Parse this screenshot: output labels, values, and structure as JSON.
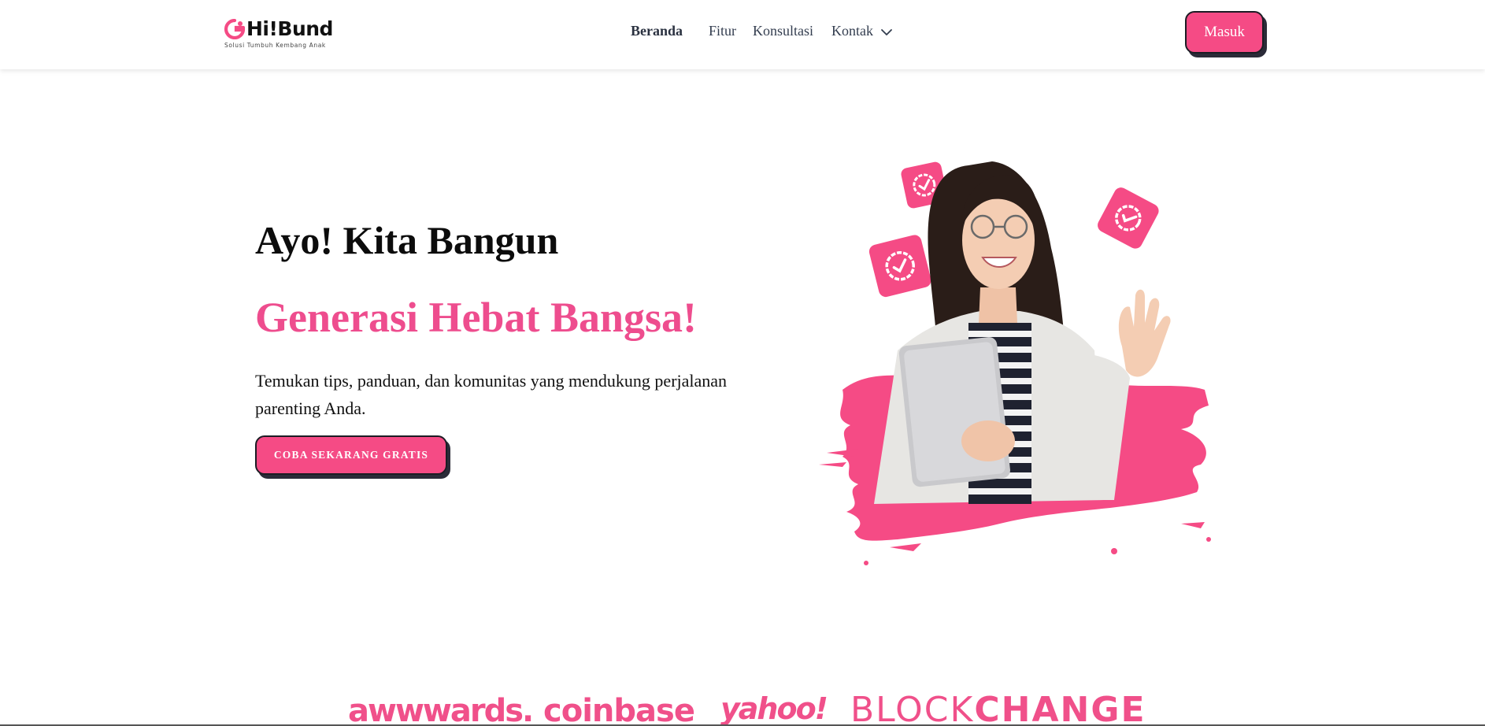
{
  "brand": {
    "name": "Hi!Bund",
    "tagline": "Solusi Tumbuh Kembang Anak",
    "accent": "#f54b85",
    "accent_text": "#ee4d8e"
  },
  "nav": {
    "items": [
      {
        "label": "Beranda",
        "active": true
      },
      {
        "label": "Fitur",
        "active": false
      },
      {
        "label": "Konsultasi",
        "active": false
      },
      {
        "label": "Kontak",
        "active": false,
        "icon": "chevron-down-icon"
      }
    ],
    "login_label": "Masuk"
  },
  "hero": {
    "title": "Ayo! Kita Bangun",
    "subtitle": "Generasi Hebat Bangsa!",
    "description": "Temukan tips, panduan, dan komunitas yang mendukung perjalanan parenting Anda.",
    "cta_label": "COBA SEKARANG GRATIS",
    "illustration": "woman-holding-laptop-waving-illustration",
    "badge_icon": "check-badge-icon"
  },
  "partners": {
    "logos": [
      "awwwards.",
      "coinbase",
      "yahoo!",
      "BLOCK",
      "CHANGE"
    ]
  }
}
